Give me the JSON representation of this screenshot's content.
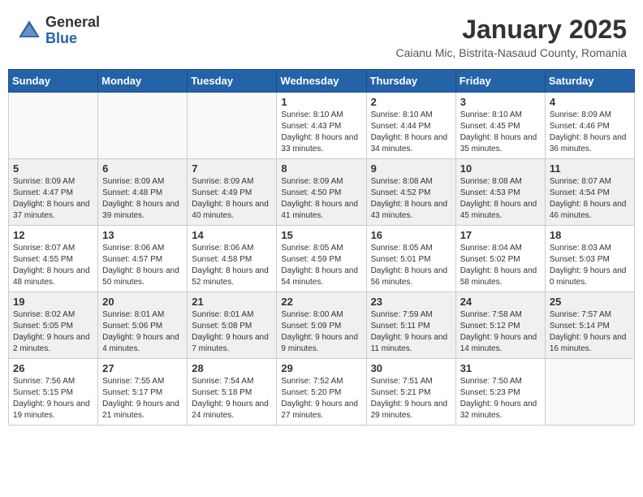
{
  "logo": {
    "general": "General",
    "blue": "Blue"
  },
  "header": {
    "month": "January 2025",
    "location": "Caianu Mic, Bistrita-Nasaud County, Romania"
  },
  "weekdays": [
    "Sunday",
    "Monday",
    "Tuesday",
    "Wednesday",
    "Thursday",
    "Friday",
    "Saturday"
  ],
  "weeks": [
    {
      "shaded": false,
      "days": [
        {
          "num": "",
          "info": ""
        },
        {
          "num": "",
          "info": ""
        },
        {
          "num": "",
          "info": ""
        },
        {
          "num": "1",
          "info": "Sunrise: 8:10 AM\nSunset: 4:43 PM\nDaylight: 8 hours and 33 minutes."
        },
        {
          "num": "2",
          "info": "Sunrise: 8:10 AM\nSunset: 4:44 PM\nDaylight: 8 hours and 34 minutes."
        },
        {
          "num": "3",
          "info": "Sunrise: 8:10 AM\nSunset: 4:45 PM\nDaylight: 8 hours and 35 minutes."
        },
        {
          "num": "4",
          "info": "Sunrise: 8:09 AM\nSunset: 4:46 PM\nDaylight: 8 hours and 36 minutes."
        }
      ]
    },
    {
      "shaded": true,
      "days": [
        {
          "num": "5",
          "info": "Sunrise: 8:09 AM\nSunset: 4:47 PM\nDaylight: 8 hours and 37 minutes."
        },
        {
          "num": "6",
          "info": "Sunrise: 8:09 AM\nSunset: 4:48 PM\nDaylight: 8 hours and 39 minutes."
        },
        {
          "num": "7",
          "info": "Sunrise: 8:09 AM\nSunset: 4:49 PM\nDaylight: 8 hours and 40 minutes."
        },
        {
          "num": "8",
          "info": "Sunrise: 8:09 AM\nSunset: 4:50 PM\nDaylight: 8 hours and 41 minutes."
        },
        {
          "num": "9",
          "info": "Sunrise: 8:08 AM\nSunset: 4:52 PM\nDaylight: 8 hours and 43 minutes."
        },
        {
          "num": "10",
          "info": "Sunrise: 8:08 AM\nSunset: 4:53 PM\nDaylight: 8 hours and 45 minutes."
        },
        {
          "num": "11",
          "info": "Sunrise: 8:07 AM\nSunset: 4:54 PM\nDaylight: 8 hours and 46 minutes."
        }
      ]
    },
    {
      "shaded": false,
      "days": [
        {
          "num": "12",
          "info": "Sunrise: 8:07 AM\nSunset: 4:55 PM\nDaylight: 8 hours and 48 minutes."
        },
        {
          "num": "13",
          "info": "Sunrise: 8:06 AM\nSunset: 4:57 PM\nDaylight: 8 hours and 50 minutes."
        },
        {
          "num": "14",
          "info": "Sunrise: 8:06 AM\nSunset: 4:58 PM\nDaylight: 8 hours and 52 minutes."
        },
        {
          "num": "15",
          "info": "Sunrise: 8:05 AM\nSunset: 4:59 PM\nDaylight: 8 hours and 54 minutes."
        },
        {
          "num": "16",
          "info": "Sunrise: 8:05 AM\nSunset: 5:01 PM\nDaylight: 8 hours and 56 minutes."
        },
        {
          "num": "17",
          "info": "Sunrise: 8:04 AM\nSunset: 5:02 PM\nDaylight: 8 hours and 58 minutes."
        },
        {
          "num": "18",
          "info": "Sunrise: 8:03 AM\nSunset: 5:03 PM\nDaylight: 9 hours and 0 minutes."
        }
      ]
    },
    {
      "shaded": true,
      "days": [
        {
          "num": "19",
          "info": "Sunrise: 8:02 AM\nSunset: 5:05 PM\nDaylight: 9 hours and 2 minutes."
        },
        {
          "num": "20",
          "info": "Sunrise: 8:01 AM\nSunset: 5:06 PM\nDaylight: 9 hours and 4 minutes."
        },
        {
          "num": "21",
          "info": "Sunrise: 8:01 AM\nSunset: 5:08 PM\nDaylight: 9 hours and 7 minutes."
        },
        {
          "num": "22",
          "info": "Sunrise: 8:00 AM\nSunset: 5:09 PM\nDaylight: 9 hours and 9 minutes."
        },
        {
          "num": "23",
          "info": "Sunrise: 7:59 AM\nSunset: 5:11 PM\nDaylight: 9 hours and 11 minutes."
        },
        {
          "num": "24",
          "info": "Sunrise: 7:58 AM\nSunset: 5:12 PM\nDaylight: 9 hours and 14 minutes."
        },
        {
          "num": "25",
          "info": "Sunrise: 7:57 AM\nSunset: 5:14 PM\nDaylight: 9 hours and 16 minutes."
        }
      ]
    },
    {
      "shaded": false,
      "days": [
        {
          "num": "26",
          "info": "Sunrise: 7:56 AM\nSunset: 5:15 PM\nDaylight: 9 hours and 19 minutes."
        },
        {
          "num": "27",
          "info": "Sunrise: 7:55 AM\nSunset: 5:17 PM\nDaylight: 9 hours and 21 minutes."
        },
        {
          "num": "28",
          "info": "Sunrise: 7:54 AM\nSunset: 5:18 PM\nDaylight: 9 hours and 24 minutes."
        },
        {
          "num": "29",
          "info": "Sunrise: 7:52 AM\nSunset: 5:20 PM\nDaylight: 9 hours and 27 minutes."
        },
        {
          "num": "30",
          "info": "Sunrise: 7:51 AM\nSunset: 5:21 PM\nDaylight: 9 hours and 29 minutes."
        },
        {
          "num": "31",
          "info": "Sunrise: 7:50 AM\nSunset: 5:23 PM\nDaylight: 9 hours and 32 minutes."
        },
        {
          "num": "",
          "info": ""
        }
      ]
    }
  ]
}
